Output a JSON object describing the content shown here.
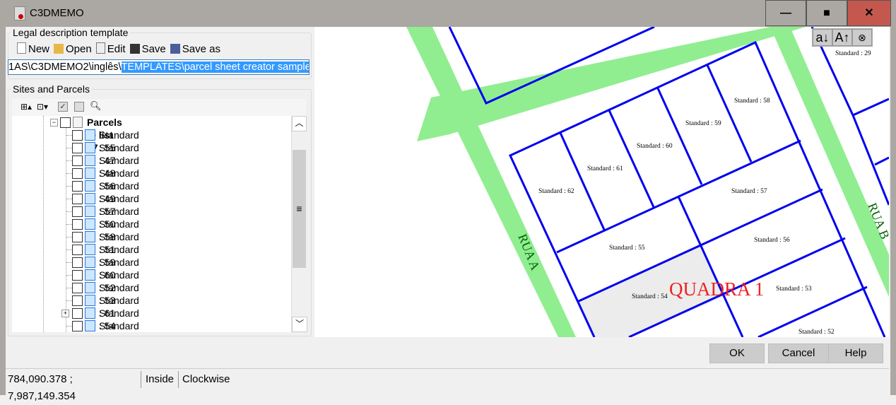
{
  "window": {
    "title": "C3DMEMO",
    "minimize": "—",
    "maximize": "■",
    "close": "✕"
  },
  "template": {
    "group_label": "Legal description template",
    "toolbar": {
      "new": "New",
      "open": "Open",
      "edit": "Edit",
      "save": "Save",
      "save_as": "Save as"
    },
    "path_prefix": "1AS\\C3DMEMO2\\inglês\\",
    "path_selected": "TEMPLATES\\parcel sheet creator sample.psc"
  },
  "sites": {
    "group_label": "Sites and Parcels",
    "root": "Parcels -> list 17",
    "items": [
      "Standard : 55",
      "Standard : 47",
      "Standard : 48",
      "Standard : 56",
      "Standard : 49",
      "Standard : 57",
      "Standard : 50",
      "Standard : 58",
      "Standard : 51",
      "Standard : 59",
      "Standard : 60",
      "Standard : 52",
      "Standard : 53",
      "Standard : 61",
      "Standard : 54",
      "Standard : 46"
    ]
  },
  "map": {
    "tools": [
      "a↓",
      "A↑",
      "⊗"
    ],
    "block_label": "QUADRA 1",
    "streets": [
      "RUA A",
      "RUA B"
    ],
    "parcels": {
      "p29": "Standard : 29",
      "p58": "Standard : 58",
      "p59": "Standard : 59",
      "p60": "Standard : 60",
      "p61": "Standard : 61",
      "p62": "Standard : 62",
      "p57": "Standard : 57",
      "p55": "Standard : 55",
      "p56": "Standard : 56",
      "p54": "Standard : 54",
      "p53": "Standard : 53",
      "p52": "Standard : 52"
    }
  },
  "buttons": {
    "ok": "OK",
    "cancel": "Cancel",
    "help": "Help"
  },
  "status": {
    "coords": "784,090.378 ; 7,987,149.354",
    "inside": "Inside",
    "orientation": "Clockwise"
  }
}
